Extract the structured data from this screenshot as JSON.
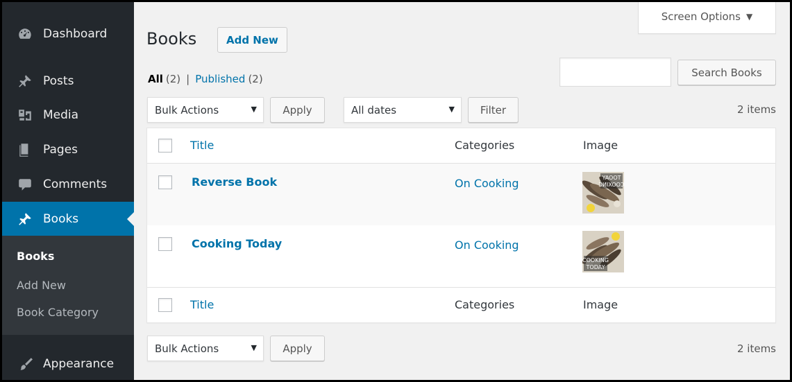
{
  "sidebar": {
    "items": [
      {
        "label": "Dashboard",
        "icon": "dashboard-icon"
      },
      {
        "label": "Posts",
        "icon": "pin-icon"
      },
      {
        "label": "Media",
        "icon": "media-icon"
      },
      {
        "label": "Pages",
        "icon": "pages-icon"
      },
      {
        "label": "Comments",
        "icon": "comment-icon"
      },
      {
        "label": "Books",
        "icon": "pin-icon",
        "active": true
      },
      {
        "label": "Appearance",
        "icon": "brush-icon"
      }
    ],
    "submenu": [
      {
        "label": "Books",
        "current": true
      },
      {
        "label": "Add New"
      },
      {
        "label": "Book Category"
      }
    ]
  },
  "header": {
    "title": "Books",
    "add_new": "Add New",
    "screen_options": "Screen Options",
    "screen_options_caret": "▼"
  },
  "views": {
    "all": "All",
    "all_count": "(2)",
    "separator": "|",
    "published": "Published",
    "published_count": "(2)"
  },
  "search": {
    "value": "",
    "button": "Search Books"
  },
  "tablenav_top": {
    "bulk_actions": "Bulk Actions",
    "apply": "Apply",
    "date_filter": "All dates",
    "filter": "Filter",
    "items": "2 items",
    "caret": "▼"
  },
  "table": {
    "columns": {
      "title": "Title",
      "categories": "Categories",
      "image": "Image"
    },
    "rows": [
      {
        "title": "Reverse Book",
        "category": "On Cooking",
        "image_caption": "COOKING TODAY (mirrored)"
      },
      {
        "title": "Cooking Today",
        "category": "On Cooking",
        "image_caption": "COOKING TODAY"
      }
    ]
  },
  "tablenav_bottom": {
    "bulk_actions": "Bulk Actions",
    "apply": "Apply",
    "items": "2 items"
  },
  "colors": {
    "sidebar_bg": "#23282d",
    "active_bg": "#0073aa",
    "link": "#0073aa",
    "page_bg": "#f1f1f1"
  }
}
